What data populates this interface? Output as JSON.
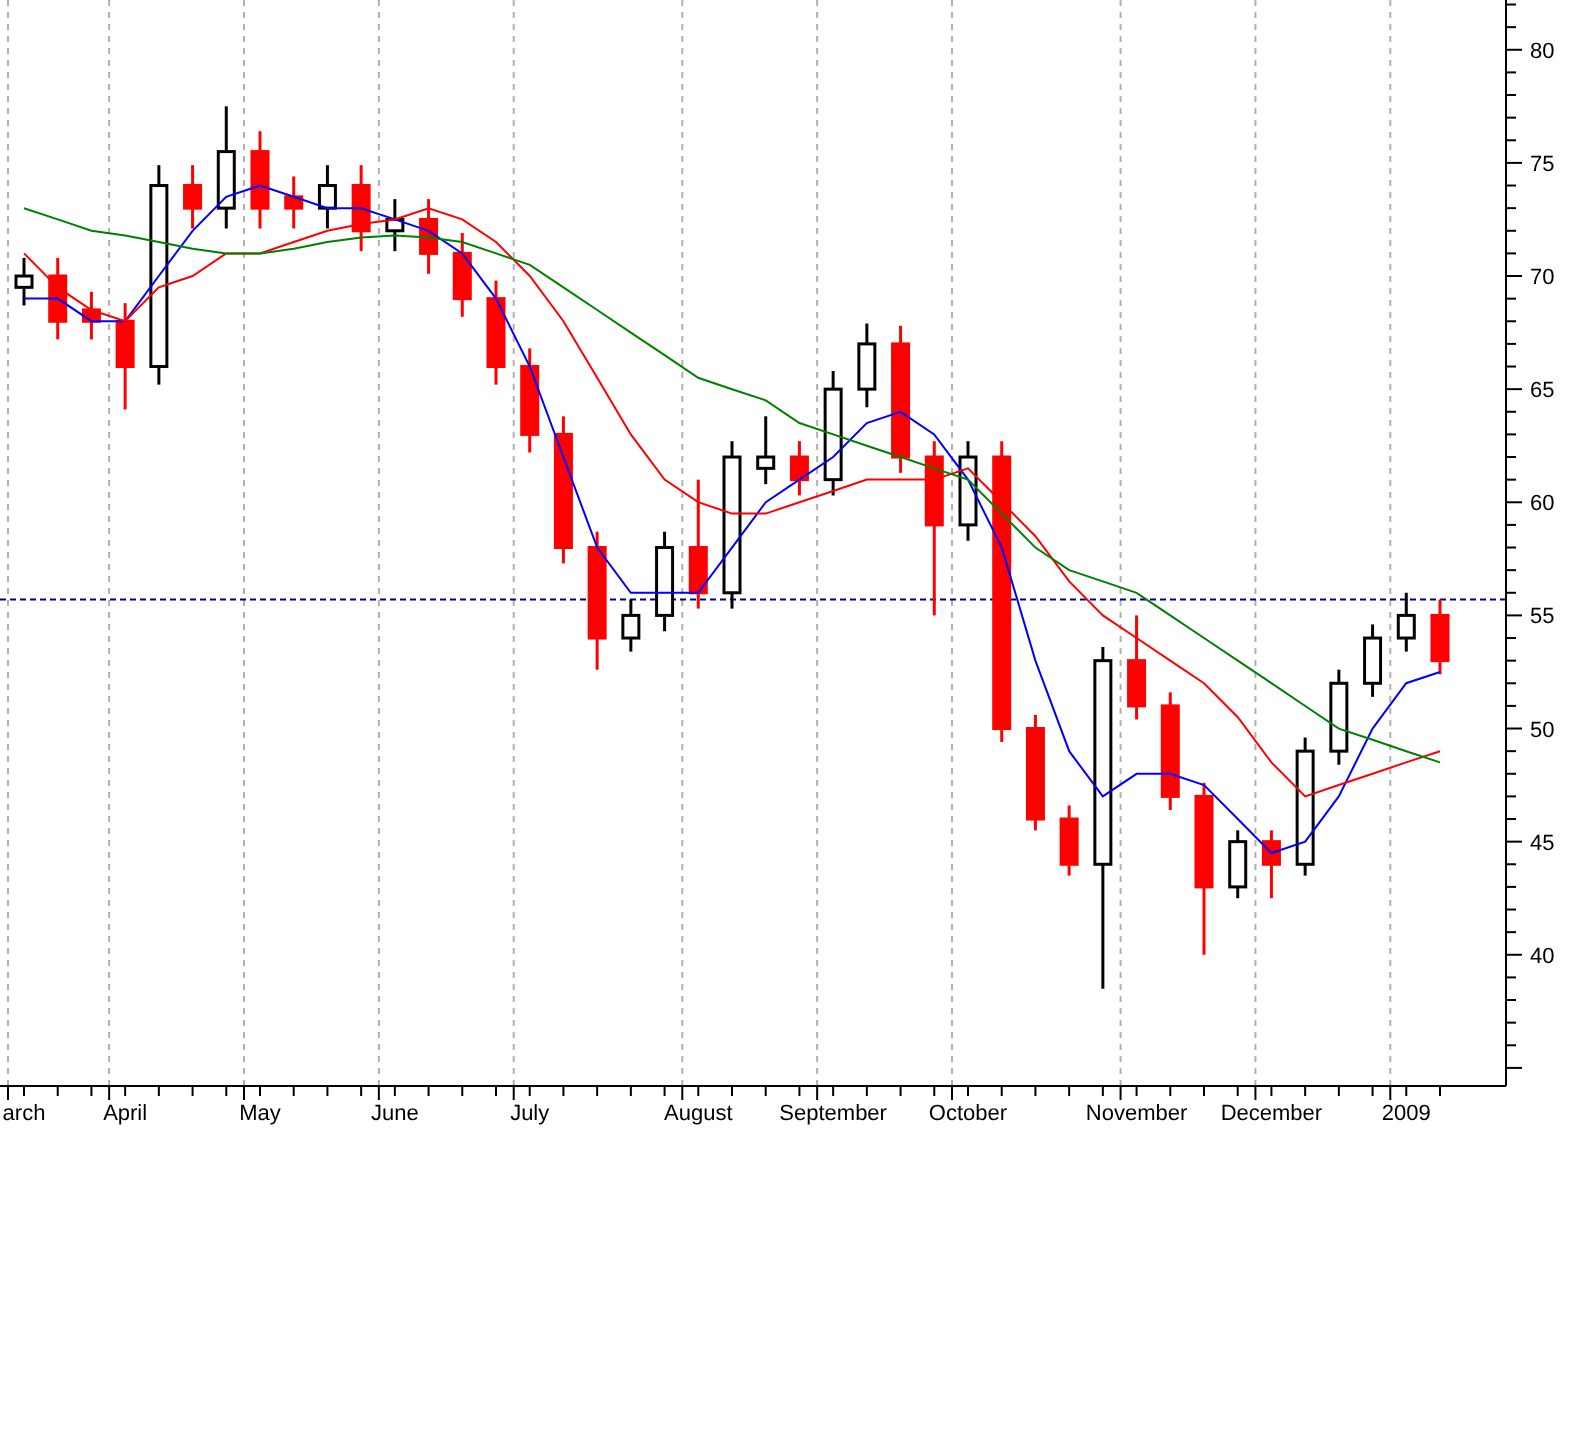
{
  "chart": {
    "chart_data": {
      "type": "candlestick",
      "ylim": [
        34.2,
        82.2
      ],
      "grid": true,
      "yticks": [
        40,
        45,
        50,
        55,
        60,
        65,
        70,
        75,
        80
      ],
      "categories": [
        "arch",
        null,
        null,
        "April",
        null,
        null,
        null,
        "May",
        null,
        null,
        null,
        "June",
        null,
        null,
        null,
        "July",
        null,
        null,
        null,
        null,
        "August",
        null,
        null,
        null,
        "September",
        null,
        null,
        null,
        "October",
        null,
        null,
        null,
        null,
        "November",
        null,
        null,
        null,
        "December",
        null,
        null,
        null,
        "2009",
        null
      ],
      "ohlc": [
        [
          69.5,
          70.8,
          68.7,
          70
        ],
        [
          70,
          70.8,
          67.2,
          68
        ],
        [
          68.5,
          69.3,
          67.2,
          68
        ],
        [
          68,
          68.8,
          64.1,
          66
        ],
        [
          66,
          74.9,
          65.2,
          74
        ],
        [
          74,
          74.9,
          72.1,
          73
        ],
        [
          73,
          77.5,
          72.1,
          75.5
        ],
        [
          75.5,
          76.4,
          72.1,
          73
        ],
        [
          73.5,
          74.4,
          72.1,
          73
        ],
        [
          73,
          74.9,
          72.1,
          74
        ],
        [
          74,
          74.9,
          71.1,
          72
        ],
        [
          72,
          73.4,
          71.1,
          72.5
        ],
        [
          72.5,
          73.4,
          70.1,
          71
        ],
        [
          71,
          71.9,
          68.2,
          69
        ],
        [
          69,
          69.8,
          65.2,
          66
        ],
        [
          66,
          66.8,
          62.2,
          63
        ],
        [
          63,
          63.8,
          57.3,
          58
        ],
        [
          58,
          58.7,
          52.6,
          54
        ],
        [
          54,
          55.7,
          53.4,
          55
        ],
        [
          55,
          58.7,
          54.3,
          58
        ],
        [
          58,
          61,
          55.3,
          56
        ],
        [
          56,
          62.7,
          55.3,
          62
        ],
        [
          61.5,
          63.8,
          60.8,
          62
        ],
        [
          62,
          62.7,
          60.3,
          61
        ],
        [
          61,
          65.8,
          60.3,
          65
        ],
        [
          65,
          67.9,
          64.2,
          67
        ],
        [
          67,
          67.8,
          61.3,
          62
        ],
        [
          62,
          62.7,
          55,
          59
        ],
        [
          59,
          62.7,
          58.3,
          62
        ],
        [
          62,
          62.7,
          49.4,
          50
        ],
        [
          50,
          50.6,
          45.5,
          46
        ],
        [
          46,
          46.6,
          43.5,
          44
        ],
        [
          44,
          53.6,
          38.5,
          53
        ],
        [
          53,
          55,
          50.4,
          51
        ],
        [
          51,
          51.6,
          46.4,
          47
        ],
        [
          47,
          47.6,
          40,
          43
        ],
        [
          43,
          45.5,
          42.5,
          45
        ],
        [
          45,
          45.5,
          42.5,
          44
        ],
        [
          44,
          49.6,
          43.5,
          49
        ],
        [
          49,
          52.6,
          48.4,
          52
        ],
        [
          52,
          54.6,
          51.4,
          54
        ],
        [
          54,
          56,
          53.4,
          55
        ],
        [
          55,
          55.7,
          52.4,
          53
        ]
      ],
      "series": [
        {
          "type": "line",
          "color": "#0000ff",
          "values": [
            69,
            69,
            68,
            68,
            70,
            72,
            73.5,
            74,
            73.5,
            73,
            73,
            72.5,
            72,
            71,
            69,
            66,
            62,
            58,
            56,
            56,
            56,
            58,
            60,
            61,
            62,
            63.5,
            64,
            63,
            61,
            58,
            53,
            49,
            47,
            48,
            48,
            47.5,
            46,
            44.5,
            45,
            47,
            50,
            52,
            52.5
          ]
        },
        {
          "type": "line",
          "color": "#ff0000",
          "values": [
            71,
            69.5,
            68.5,
            68,
            69.5,
            70,
            71,
            71,
            71.5,
            72,
            72.3,
            72.5,
            73,
            72.5,
            71.5,
            70,
            68,
            65.5,
            63,
            61,
            60,
            59.5,
            59.5,
            60,
            60.5,
            61,
            61,
            61,
            61.5,
            60,
            58.5,
            56.5,
            55,
            54,
            53,
            52,
            50.5,
            48.5,
            47,
            47.5,
            48,
            48.5,
            49
          ]
        },
        {
          "type": "line",
          "color": "#008000",
          "values": [
            73,
            72.5,
            72,
            71.8,
            71.5,
            71.2,
            71,
            71,
            71.2,
            71.5,
            71.7,
            71.8,
            71.7,
            71.5,
            71,
            70.5,
            69.5,
            68.5,
            67.5,
            66.5,
            65.5,
            65,
            64.5,
            63.5,
            63,
            62.5,
            62,
            61.5,
            61,
            59.5,
            58,
            57,
            56.5,
            56,
            55,
            54,
            53,
            52,
            51,
            50,
            49.5,
            49,
            48.5
          ]
        }
      ],
      "ref_lines": [
        {
          "axis": "y",
          "value": 55.7
        }
      ]
    }
  }
}
